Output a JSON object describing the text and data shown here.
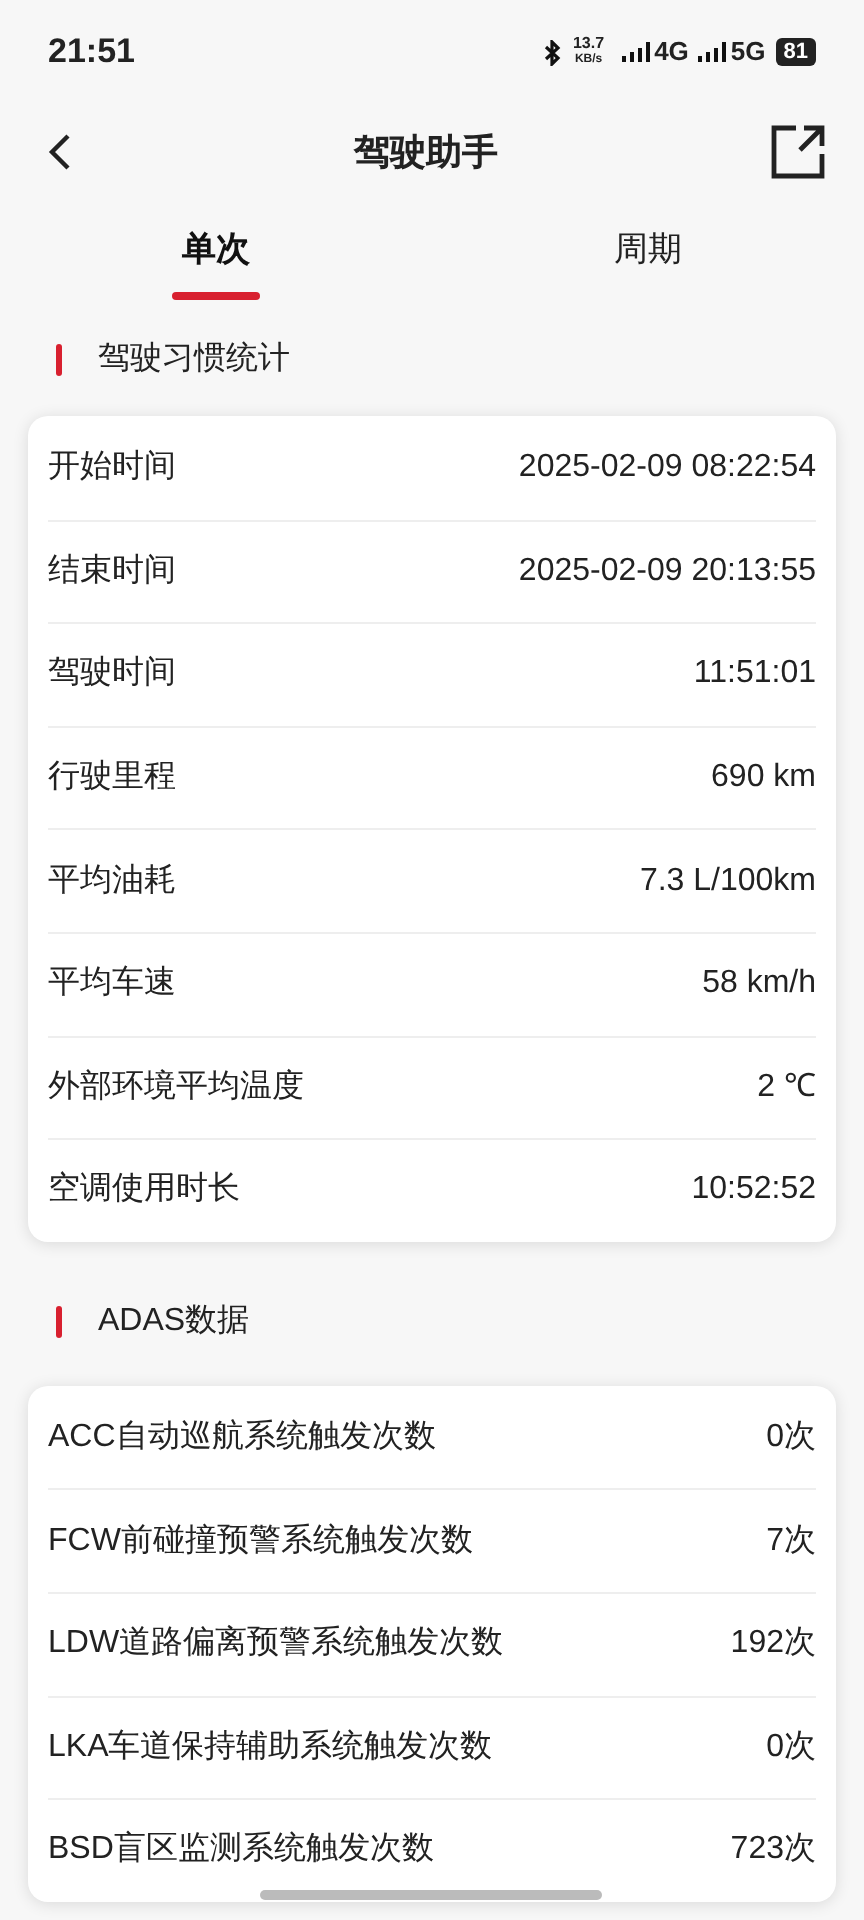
{
  "status_bar": {
    "time": "21:51",
    "net_speed_value": "13.7",
    "net_speed_unit": "KB/s",
    "network_1": "4G",
    "network_2": "5G",
    "battery": "81"
  },
  "header": {
    "title": "驾驶助手"
  },
  "tabs": [
    {
      "label": "单次",
      "selected": true
    },
    {
      "label": "周期",
      "selected": false
    }
  ],
  "sections": [
    {
      "title": "驾驶习惯统计",
      "rows": [
        {
          "label": "开始时间",
          "value": "2025-02-09 08:22:54"
        },
        {
          "label": "结束时间",
          "value": "2025-02-09 20:13:55"
        },
        {
          "label": "驾驶时间",
          "value": "11:51:01"
        },
        {
          "label": "行驶里程",
          "value": "690 km"
        },
        {
          "label": "平均油耗",
          "value": "7.3 L/100km"
        },
        {
          "label": "平均车速",
          "value": "58 km/h"
        },
        {
          "label": "外部环境平均温度",
          "value": "2 ℃"
        },
        {
          "label": "空调使用时长",
          "value": "10:52:52"
        }
      ]
    },
    {
      "title": "ADAS数据",
      "rows": [
        {
          "label": "ACC自动巡航系统触发次数",
          "value": "0次"
        },
        {
          "label": "FCW前碰撞预警系统触发次数",
          "value": "7次"
        },
        {
          "label": "LDW道路偏离预警系统触发次数",
          "value": "192次"
        },
        {
          "label": "LKA车道保持辅助系统触发次数",
          "value": "0次"
        },
        {
          "label": "BSD盲区监测系统触发次数",
          "value": "723次"
        }
      ]
    }
  ]
}
